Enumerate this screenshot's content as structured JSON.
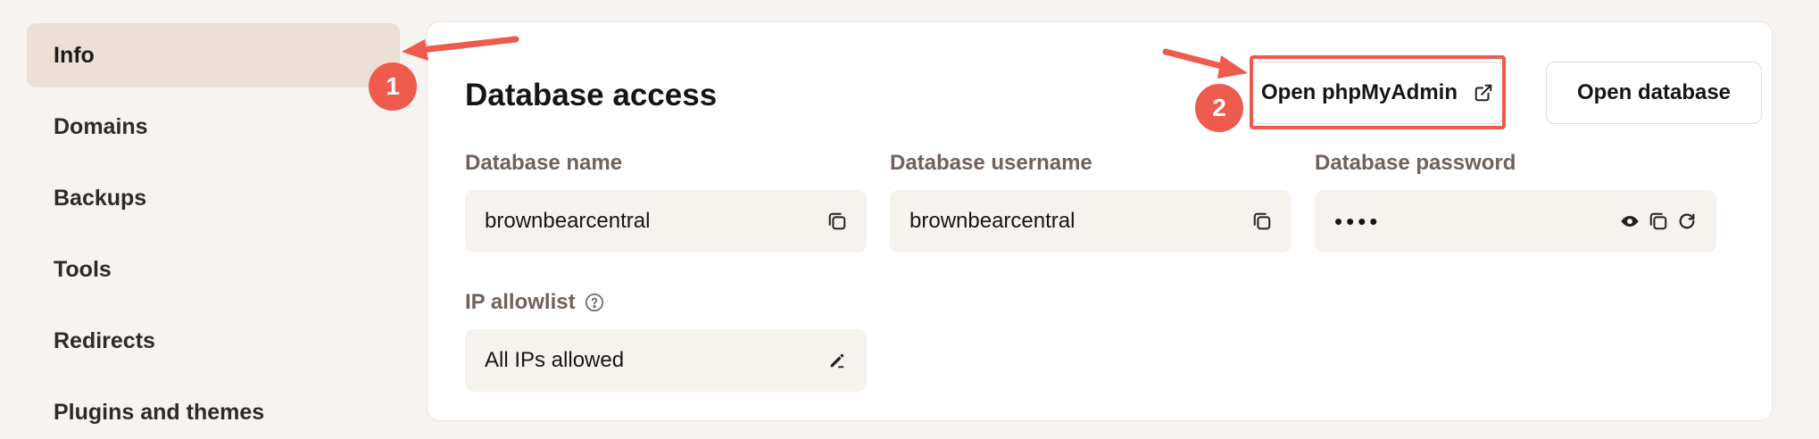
{
  "sidebar": {
    "items": [
      {
        "label": "Info",
        "active": true
      },
      {
        "label": "Domains"
      },
      {
        "label": "Backups"
      },
      {
        "label": "Tools"
      },
      {
        "label": "Redirects"
      },
      {
        "label": "Plugins and themes"
      }
    ]
  },
  "main": {
    "title": "Database access",
    "buttons": {
      "phpmyadmin": "Open phpMyAdmin",
      "database": "Open database"
    },
    "fields": {
      "db_name": {
        "label": "Database name",
        "value": "brownbearcentral"
      },
      "db_username": {
        "label": "Database username",
        "value": "brownbearcentral"
      },
      "db_password": {
        "label": "Database password",
        "value": "••••"
      },
      "ip_allowlist": {
        "label": "IP allowlist",
        "value": "All IPs allowed"
      }
    }
  },
  "annotations": {
    "badge_1": "1",
    "badge_2": "2"
  },
  "colors": {
    "accent": "#ee5a4d",
    "active_bg": "#ecdfd6",
    "page_bg": "#f7f3f0"
  }
}
